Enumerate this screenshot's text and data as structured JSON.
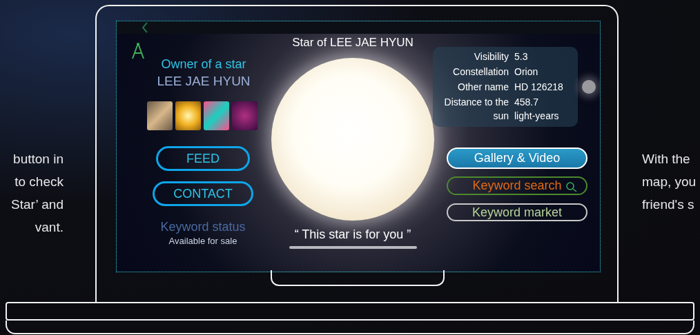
{
  "side_text_left": [
    "button in",
    "to check",
    "Star’ and",
    "vant."
  ],
  "side_text_right": [
    "With the",
    "map, you",
    "friend's s"
  ],
  "screen": {
    "title": "Star of LEE JAE HYUN",
    "owner_label": "Owner of a star",
    "owner_name": "LEE JAE HYUN",
    "buttons_left": [
      "FEED",
      "CONTACT"
    ],
    "keyword_status": {
      "label": "Keyword status",
      "value": "Available for sale"
    },
    "quote": "“ This star is for you ”",
    "info": [
      {
        "label": "Visibility",
        "value": "5.3"
      },
      {
        "label": "Constellation",
        "value": "Orion"
      },
      {
        "label": "Other name",
        "value": "HD 126218"
      },
      {
        "label": "Distance to the sun",
        "value": "458.7 light-years"
      }
    ],
    "actions": [
      {
        "kind": "primary",
        "label": "Gallery & Video"
      },
      {
        "kind": "search",
        "label": "Keyword search"
      },
      {
        "kind": "market",
        "label": "Keyword market"
      }
    ]
  }
}
